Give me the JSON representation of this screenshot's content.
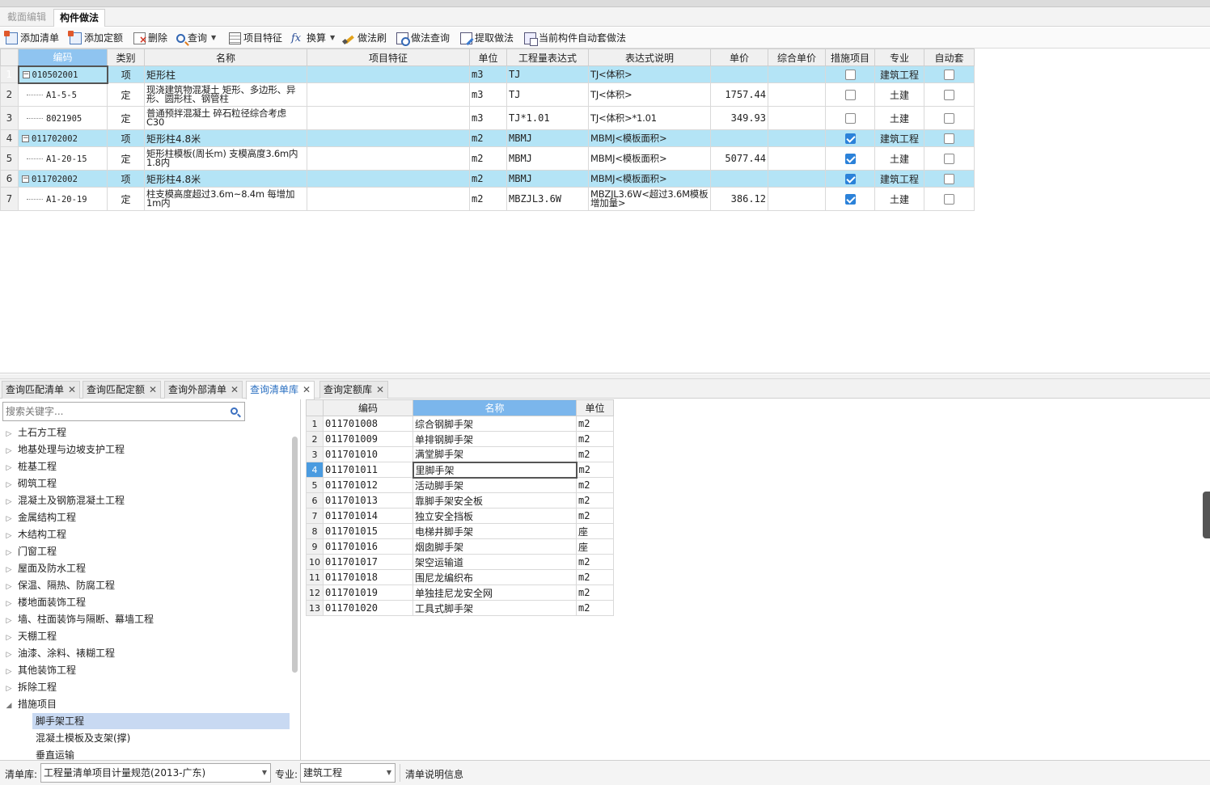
{
  "tabs": {
    "section_edit": "截面编辑",
    "component_method": "构件做法"
  },
  "toolbar": {
    "add_list": "添加清单",
    "add_quota": "添加定额",
    "delete": "删除",
    "query": "查询",
    "item_feature": "项目特征",
    "convert": "换算",
    "method_brush": "做法刷",
    "method_query": "做法查询",
    "extract_method": "提取做法",
    "auto_apply": "当前构件自动套做法"
  },
  "main_table": {
    "headers": {
      "code": "编码",
      "type": "类别",
      "name": "名称",
      "feature": "项目特征",
      "unit": "单位",
      "expr": "工程量表达式",
      "expr_desc": "表达式说明",
      "price": "单价",
      "total_price": "综合单价",
      "measure": "措施项目",
      "discipline": "专业",
      "auto": "自动套"
    },
    "rows": [
      {
        "no": "1",
        "code": "010502001",
        "type": "项",
        "name": "矩形柱",
        "unit": "m3",
        "expr": "TJ",
        "desc": "TJ<体积>",
        "price": "",
        "measure": false,
        "discipline": "建筑工程",
        "auto": false
      },
      {
        "no": "2",
        "code": "A1-5-5",
        "type": "定",
        "name": "现浇建筑物混凝土 矩形、多边形、异形、圆形柱、钢管柱",
        "unit": "m3",
        "expr": "TJ",
        "desc": "TJ<体积>",
        "price": "1757.44",
        "measure": false,
        "discipline": "土建",
        "auto": false
      },
      {
        "no": "3",
        "code": "8021905",
        "type": "定",
        "name": "普通预拌混凝土 碎石粒径综合考虑 C30",
        "unit": "m3",
        "expr": "TJ*1.01",
        "desc": "TJ<体积>*1.01",
        "price": "349.93",
        "measure": false,
        "discipline": "土建",
        "auto": false
      },
      {
        "no": "4",
        "code": "011702002",
        "type": "项",
        "name": "矩形柱4.8米",
        "unit": "m2",
        "expr": "MBMJ",
        "desc": "MBMJ<模板面积>",
        "price": "",
        "measure": true,
        "discipline": "建筑工程",
        "auto": false
      },
      {
        "no": "5",
        "code": "A1-20-15",
        "type": "定",
        "name": "矩形柱模板(周长m) 支模高度3.6m内 1.8内",
        "unit": "m2",
        "expr": "MBMJ",
        "desc": "MBMJ<模板面积>",
        "price": "5077.44",
        "measure": true,
        "discipline": "土建",
        "auto": false
      },
      {
        "no": "6",
        "code": "011702002",
        "type": "项",
        "name": "矩形柱4.8米",
        "unit": "m2",
        "expr": "MBMJ",
        "desc": "MBMJ<模板面积>",
        "price": "",
        "measure": true,
        "discipline": "建筑工程",
        "auto": false
      },
      {
        "no": "7",
        "code": "A1-20-19",
        "type": "定",
        "name": "柱支模高度超过3.6m~8.4m 每增加1m内",
        "unit": "m2",
        "expr": "MBZJL3.6W",
        "desc": "MBZJL3.6W<超过3.6M模板增加量>",
        "price": "386.12",
        "measure": true,
        "discipline": "土建",
        "auto": false
      }
    ]
  },
  "bottom_tabs": [
    "查询匹配清单",
    "查询匹配定额",
    "查询外部清单",
    "查询清单库",
    "查询定额库"
  ],
  "search": {
    "placeholder": "搜索关键字..."
  },
  "tree": {
    "nodes": [
      "土石方工程",
      "地基处理与边坡支护工程",
      "桩基工程",
      "砌筑工程",
      "混凝土及钢筋混凝土工程",
      "金属结构工程",
      "木结构工程",
      "门窗工程",
      "屋面及防水工程",
      "保温、隔热、防腐工程",
      "楼地面装饰工程",
      "墙、柱面装饰与隔断、幕墙工程",
      "天棚工程",
      "油漆、涂料、裱糊工程",
      "其他装饰工程",
      "拆除工程",
      "措施项目"
    ],
    "children": [
      "脚手架工程",
      "混凝土模板及支架(撑)",
      "垂直运输"
    ]
  },
  "list_table": {
    "headers": {
      "code": "编码",
      "name": "名称",
      "unit": "单位"
    },
    "rows": [
      {
        "no": "1",
        "code": "011701008",
        "name": "综合钢脚手架",
        "unit": "m2"
      },
      {
        "no": "2",
        "code": "011701009",
        "name": "单排钢脚手架",
        "unit": "m2"
      },
      {
        "no": "3",
        "code": "011701010",
        "name": "满堂脚手架",
        "unit": "m2"
      },
      {
        "no": "4",
        "code": "011701011",
        "name": "里脚手架",
        "unit": "m2"
      },
      {
        "no": "5",
        "code": "011701012",
        "name": "活动脚手架",
        "unit": "m2"
      },
      {
        "no": "6",
        "code": "011701013",
        "name": "靠脚手架安全板",
        "unit": "m2"
      },
      {
        "no": "7",
        "code": "011701014",
        "name": "独立安全挡板",
        "unit": "m2"
      },
      {
        "no": "8",
        "code": "011701015",
        "name": "电梯井脚手架",
        "unit": "座"
      },
      {
        "no": "9",
        "code": "011701016",
        "name": "烟囱脚手架",
        "unit": "座"
      },
      {
        "no": "10",
        "code": "011701017",
        "name": "架空运输道",
        "unit": "m2"
      },
      {
        "no": "11",
        "code": "011701018",
        "name": "围尼龙编织布",
        "unit": "m2"
      },
      {
        "no": "12",
        "code": "011701019",
        "name": "单独挂尼龙安全网",
        "unit": "m2"
      },
      {
        "no": "13",
        "code": "011701020",
        "name": "工具式脚手架",
        "unit": "m2"
      }
    ]
  },
  "statusbar": {
    "library_label": "清单库:",
    "library_value": "工程量清单项目计量规范(2013-广东)",
    "discipline_label": "专业:",
    "discipline_value": "建筑工程",
    "info": "清单说明信息"
  },
  "colors": {
    "header_row": "#b4e4f6",
    "selection": "#4a9be0",
    "checked": "#2b82d9"
  }
}
